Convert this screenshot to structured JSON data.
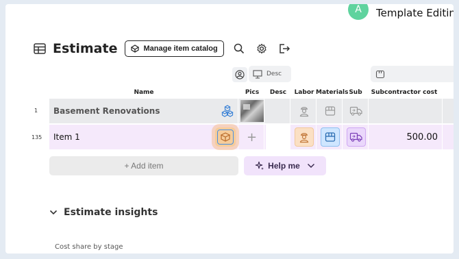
{
  "user": {
    "avatar_letter": "A",
    "project_title": "Template Editing"
  },
  "page": {
    "title": "Estimate",
    "catalog_button": "Manage item catalog"
  },
  "column_groups": {
    "desc_pill": "Desc"
  },
  "columns": {
    "name": "Name",
    "pics": "Pics",
    "desc": "Desc",
    "labor": "Labor",
    "materials": "Materials",
    "sub": "Sub",
    "subcontractor_cost": "Subcontractor cost"
  },
  "rows": [
    {
      "number": "1",
      "name": "Basement Renovations",
      "subcontractor_cost": ""
    },
    {
      "number": "135",
      "name": "Item 1",
      "pics": "+",
      "subcontractor_cost": "500.00"
    }
  ],
  "actions": {
    "add_item": "+ Add item",
    "help_me": "Help me"
  },
  "insights": {
    "title": "Estimate insights",
    "cost_share_label": "Cost share by stage"
  },
  "colors": {
    "labor_bg": "#fbe0c4",
    "materials_bg": "#cfe6ff",
    "sub_bg": "#ead7fb",
    "row_selected": "#f5e9fb",
    "avatar": "#5fd39e"
  },
  "icons": [
    "table-icon",
    "catalog-icon",
    "search-icon",
    "gear-icon",
    "export-icon",
    "user-circle-icon",
    "presentation-icon",
    "box-icon",
    "labor-worker-icon",
    "materials-box-icon",
    "delivery-truck-icon",
    "sparkle-icon",
    "chevron-down-icon"
  ]
}
